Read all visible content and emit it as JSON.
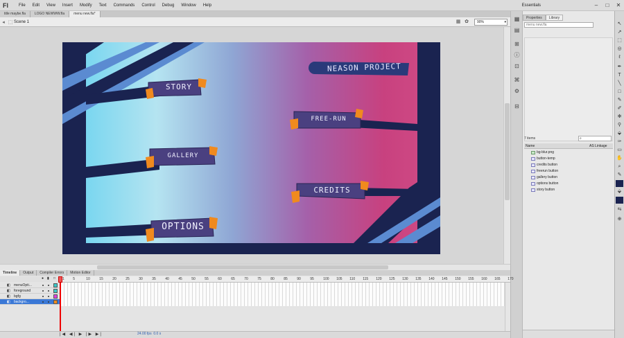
{
  "app": {
    "logo": "Fl",
    "workspace": "Essentials",
    "window_controls": [
      "–",
      "□",
      "✕"
    ]
  },
  "menu": [
    "File",
    "Edit",
    "View",
    "Insert",
    "Modify",
    "Text",
    "Commands",
    "Control",
    "Debug",
    "Window",
    "Help"
  ],
  "doc_tabs": [
    {
      "label": "title maybe.fla",
      "active": false
    },
    {
      "label": "LOGO NEWWW.fla",
      "active": false
    },
    {
      "label": "menu new.fla*",
      "active": true
    }
  ],
  "scene": {
    "label": "Scene 1",
    "zoom": "90%"
  },
  "stage": {
    "title": "NEASON PROJECT",
    "buttons": [
      {
        "label": "STORY"
      },
      {
        "label": "FREE-RUN"
      },
      {
        "label": "GALLERY"
      },
      {
        "label": "CREDITS"
      },
      {
        "label": "OPTIONS"
      }
    ],
    "colors": {
      "navy": "#1a2350",
      "stripe": "#5b8bd1",
      "button": "#4a4080",
      "tab": "#f08a1e"
    }
  },
  "library": {
    "tabs": [
      {
        "label": "Properties",
        "active": false
      },
      {
        "label": "Library",
        "active": true
      }
    ],
    "doc": "menu new.fla",
    "item_count": "7 items",
    "col_name": "Name",
    "col_linkage": "AS Linkage",
    "items": [
      {
        "name": "bg-blur.png",
        "type": "img"
      },
      {
        "name": "button-temp",
        "type": "sym"
      },
      {
        "name": "credits button",
        "type": "sym"
      },
      {
        "name": "freerun button",
        "type": "sym"
      },
      {
        "name": "gallery button",
        "type": "sym"
      },
      {
        "name": "options button",
        "type": "sym"
      },
      {
        "name": "story button",
        "type": "sym"
      }
    ]
  },
  "timeline": {
    "tabs": [
      {
        "label": "Timeline",
        "active": true
      },
      {
        "label": "Output",
        "active": false
      },
      {
        "label": "Compiler Errors",
        "active": false
      },
      {
        "label": "Motion Editor",
        "active": false
      }
    ],
    "frame_numbers": [
      "1",
      "5",
      "10",
      "15",
      "20",
      "25",
      "30",
      "35",
      "40",
      "45",
      "50",
      "55",
      "60",
      "65",
      "70",
      "75",
      "80",
      "85",
      "90",
      "95",
      "100",
      "105",
      "110",
      "115",
      "120",
      "125",
      "130",
      "135",
      "140",
      "145",
      "150",
      "155",
      "160",
      "165",
      "170"
    ],
    "layers": [
      {
        "name": "menuOpti...",
        "color": "#3cc8c8",
        "active": false
      },
      {
        "name": "foreground",
        "color": "#3cc8c8",
        "active": false
      },
      {
        "name": "bgfg",
        "color": "#e040e0",
        "active": false
      },
      {
        "name": "backgro...",
        "color": "#f08a1e",
        "active": true
      }
    ],
    "fps": "24.00 fps",
    "time": "0.0 s",
    "controls": "|◀ ◀| ▶ |▶ ▶|"
  }
}
